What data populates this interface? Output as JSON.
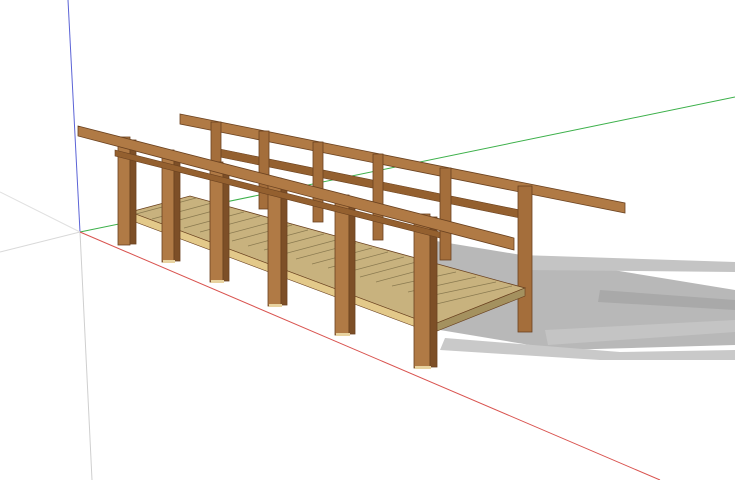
{
  "scene": {
    "subject": "wooden-footbridge-3d-model",
    "background": "#ffffff",
    "colors": {
      "wood_light": "#b07a45",
      "wood_mid": "#94602f",
      "wood_dark": "#6b4220",
      "deck_top": "#c8b27e",
      "deck_gap": "#8a7a50",
      "deck_edge": "#e3c98a",
      "shadow": "#b8b8b8",
      "axis_red": "#d9534f",
      "axis_green": "#3cb04a",
      "axis_blue": "#5b63d6"
    }
  },
  "watermark": {
    "text": ""
  }
}
